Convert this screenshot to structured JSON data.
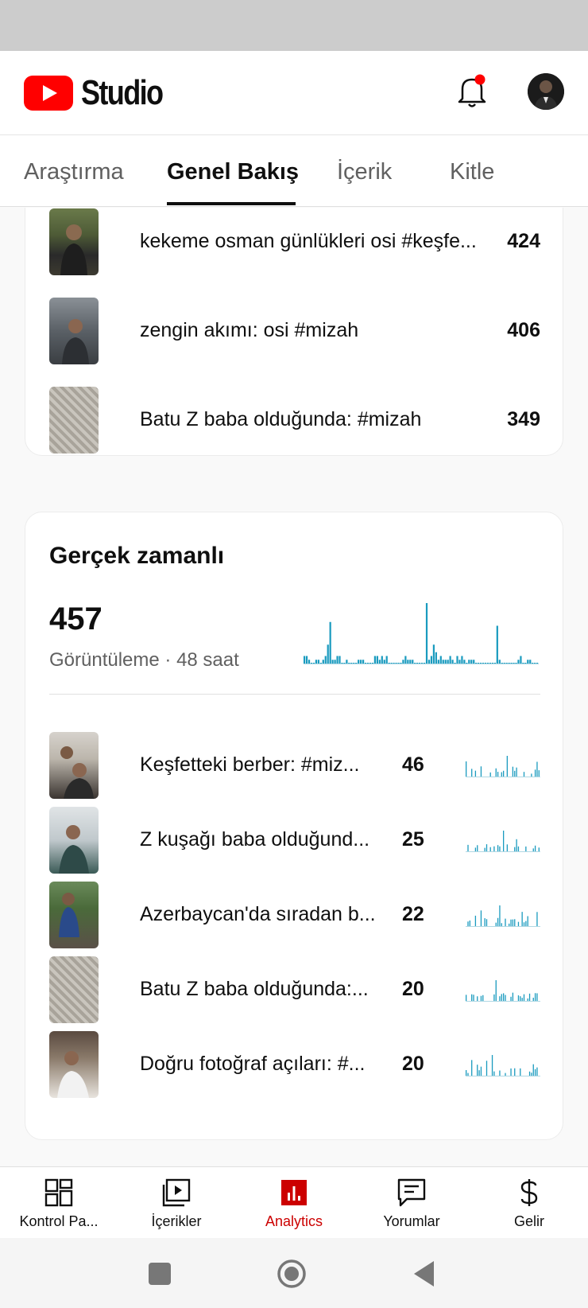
{
  "header": {
    "app_name": "Studio",
    "logo_icon": "youtube-logo-icon",
    "notification_icon": "bell-icon",
    "notification_dot_color": "#ff0000"
  },
  "tabs": [
    {
      "label": "Araştırma",
      "active": false
    },
    {
      "label": "Genel Bakış",
      "active": true
    },
    {
      "label": "İçerik",
      "active": false
    },
    {
      "label": "Kitle",
      "active": false
    }
  ],
  "top_content": {
    "rows": [
      {
        "title": "kekeme osman günlükleri osi #keşfe...",
        "value": "424"
      },
      {
        "title": "zengin akımı: osi #mizah",
        "value": "406"
      },
      {
        "title": "Batu Z baba olduğunda: #mizah",
        "value": "349"
      }
    ]
  },
  "realtime": {
    "title": "Gerçek zamanlı",
    "total": "457",
    "subtitle": "Görüntüleme · 48 saat",
    "bar_color": "#1a9bbf",
    "rows": [
      {
        "title": "Keşfetteki berber: #miz...",
        "value": "46"
      },
      {
        "title": "Z kuşağı baba olduğund...",
        "value": "25"
      },
      {
        "title": "Azerbaycan'da sıradan b...",
        "value": "22"
      },
      {
        "title": "Batu Z baba olduğunda:...",
        "value": "20"
      },
      {
        "title": "Doğru fotoğraf açıları: #...",
        "value": "20"
      }
    ]
  },
  "chart_data": {
    "type": "bar",
    "title": "",
    "xlabel": "",
    "ylabel": "",
    "values": [
      2,
      2,
      1,
      0,
      0,
      1,
      1,
      0,
      1,
      2,
      5,
      11,
      1,
      1,
      2,
      2,
      0,
      0,
      1,
      0,
      0,
      0,
      0,
      1,
      1,
      1,
      0,
      0,
      0,
      0,
      2,
      2,
      1,
      2,
      1,
      2,
      0,
      0,
      0,
      0,
      0,
      0,
      1,
      2,
      1,
      1,
      1,
      0,
      0,
      0,
      0,
      0,
      16,
      1,
      2,
      5,
      3,
      1,
      2,
      1,
      1,
      1,
      2,
      1,
      0,
      2,
      1,
      2,
      1,
      0,
      1,
      1,
      1,
      0,
      0,
      0,
      0,
      0,
      0,
      0,
      0,
      0,
      10,
      1,
      0,
      0,
      0,
      0,
      0,
      0,
      0,
      1,
      2,
      0,
      0,
      1,
      1,
      0,
      0,
      0
    ]
  },
  "bottom_nav": [
    {
      "label": "Kontrol Pa...",
      "icon": "dashboard-icon",
      "active": false
    },
    {
      "label": "İçerikler",
      "icon": "content-icon",
      "active": false
    },
    {
      "label": "Analytics",
      "icon": "analytics-icon",
      "active": true
    },
    {
      "label": "Yorumlar",
      "icon": "comments-icon",
      "active": false
    },
    {
      "label": "Gelir",
      "icon": "earn-icon",
      "active": false
    }
  ],
  "accent_color": "#cc0000"
}
